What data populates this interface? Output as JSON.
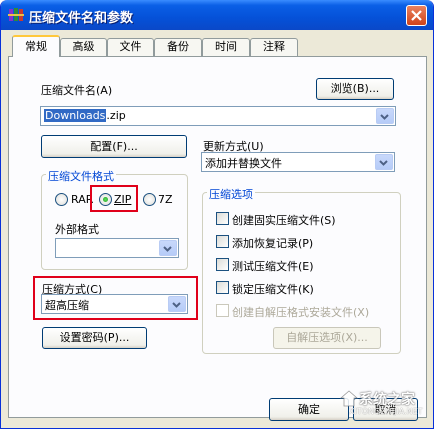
{
  "window": {
    "title": "压缩文件名和参数"
  },
  "tabs": [
    {
      "label": "常规",
      "active": true
    },
    {
      "label": "高级"
    },
    {
      "label": "文件"
    },
    {
      "label": "备份"
    },
    {
      "label": "时间"
    },
    {
      "label": "注释"
    }
  ],
  "general": {
    "archive_name_label": "压缩文件名(A)",
    "archive_name_mnemonic": "A",
    "browse_label": "浏览(B)...",
    "archive_name_selected": "Downloads",
    "archive_name_ext": ".zip",
    "profiles_label": "配置(F)...",
    "update_mode_label": "更新方式(U)",
    "update_mode_value": "添加并替换文件",
    "format_group_title": "压缩文件格式",
    "format_options": [
      "RAR",
      "ZIP",
      "7Z"
    ],
    "format_selected": "ZIP",
    "external_format_label": "外部格式",
    "external_format_value": "",
    "method_label": "压缩方式(C)",
    "method_value": "超高压缩",
    "password_label": "设置密码(P)...",
    "options_group_title": "压缩选项",
    "options": [
      {
        "label": "创建固实压缩文件(S)",
        "checked": false,
        "enabled": true
      },
      {
        "label": "添加恢复记录(P)",
        "checked": false,
        "enabled": true
      },
      {
        "label": "测试压缩文件(E)",
        "checked": false,
        "enabled": true
      },
      {
        "label": "锁定压缩文件(K)",
        "checked": false,
        "enabled": true
      },
      {
        "label": "创建自解压格式安装文件(X)",
        "checked": false,
        "enabled": false
      }
    ],
    "sfx_options_label": "自解压选项(X)..."
  },
  "footer": {
    "ok_label": "确定",
    "cancel_label": "取消"
  },
  "watermark": {
    "text": "系统之家",
    "sub": "XITONGZHIJIA.NET"
  },
  "colors": {
    "titlebar": "#0551D8",
    "highlight_box": "#E0001A",
    "group_title": "#0046D5"
  }
}
